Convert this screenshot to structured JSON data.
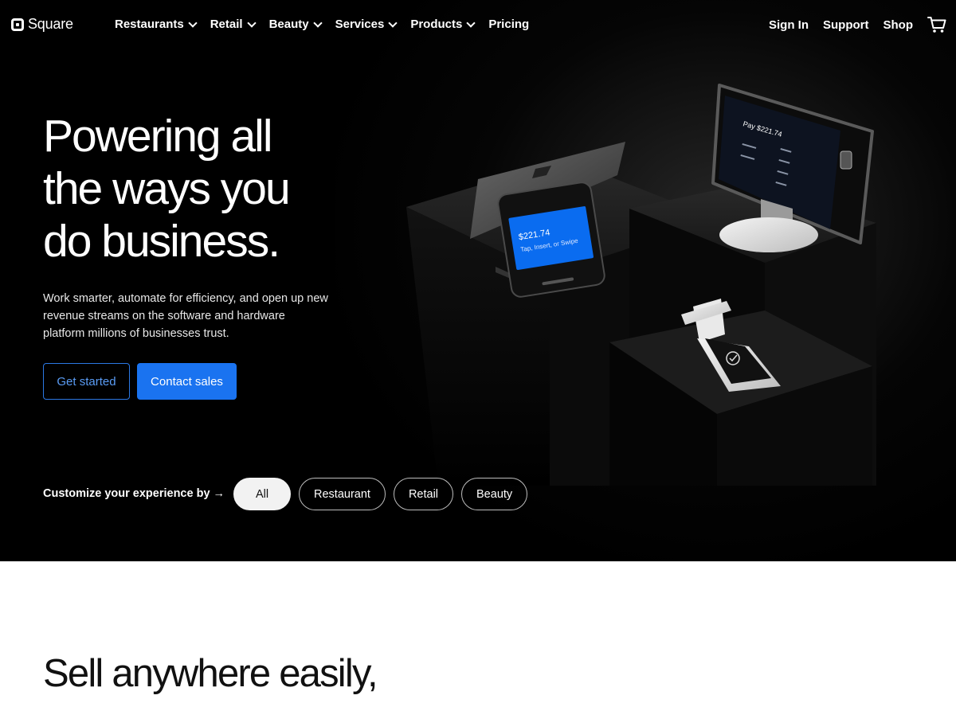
{
  "nav": {
    "logo": "Square",
    "links": [
      {
        "label": "Restaurants",
        "dropdown": true
      },
      {
        "label": "Retail",
        "dropdown": true
      },
      {
        "label": "Beauty",
        "dropdown": true
      },
      {
        "label": "Services",
        "dropdown": true
      },
      {
        "label": "Products",
        "dropdown": true
      },
      {
        "label": "Pricing",
        "dropdown": false
      }
    ],
    "right": {
      "sign_in": "Sign In",
      "support": "Support",
      "shop": "Shop",
      "cart_icon": "cart-icon"
    }
  },
  "hero": {
    "headline_line1": "Powering all",
    "headline_line2": "the ways you",
    "headline_line3": "do business.",
    "subtext": "Work smarter, automate for efficiency, and open up new revenue streams on the software and hardware platform millions of businesses trust.",
    "cta_secondary": "Get started",
    "cta_primary": "Contact sales",
    "customize_label": "Customize your experience by →",
    "filters": [
      {
        "label": "All",
        "active": true
      },
      {
        "label": "Restaurant",
        "active": false
      },
      {
        "label": "Retail",
        "active": false
      },
      {
        "label": "Beauty",
        "active": false
      }
    ],
    "devices": {
      "terminal_amount": "$221.74",
      "terminal_prompt": "Tap, Insert, or Swipe",
      "register_pay": "Pay $221.74"
    }
  },
  "section2": {
    "heading_line1": "Sell anywhere easily,"
  },
  "colors": {
    "hero_bg": "#000000",
    "accent_blue": "#1a73f0",
    "outline_blue": "#2b78e4",
    "page_bg": "#ffffff"
  }
}
